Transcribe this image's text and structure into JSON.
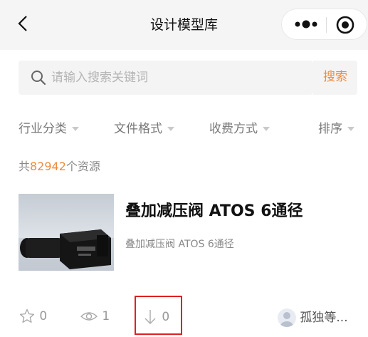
{
  "navbar": {
    "title": "设计模型库"
  },
  "search": {
    "placeholder": "请输入搜索关键词",
    "button_label": "搜索"
  },
  "filters": [
    {
      "label": "行业分类"
    },
    {
      "label": "文件格式"
    },
    {
      "label": "收费方式"
    },
    {
      "label": "排序"
    }
  ],
  "results": {
    "prefix": "共",
    "count": "82942",
    "suffix": "个资源"
  },
  "items": [
    {
      "title": "叠加减压阀 ATOS 6通径",
      "subtitle": "叠加减压阀 ATOS 6通径",
      "favorites": "0",
      "views": "1",
      "downloads": "0",
      "author": "孤独等..."
    }
  ],
  "colors": {
    "accent": "#f08a3c",
    "highlight_border": "#e02020",
    "navbar_bg": "#f5f5f5"
  }
}
